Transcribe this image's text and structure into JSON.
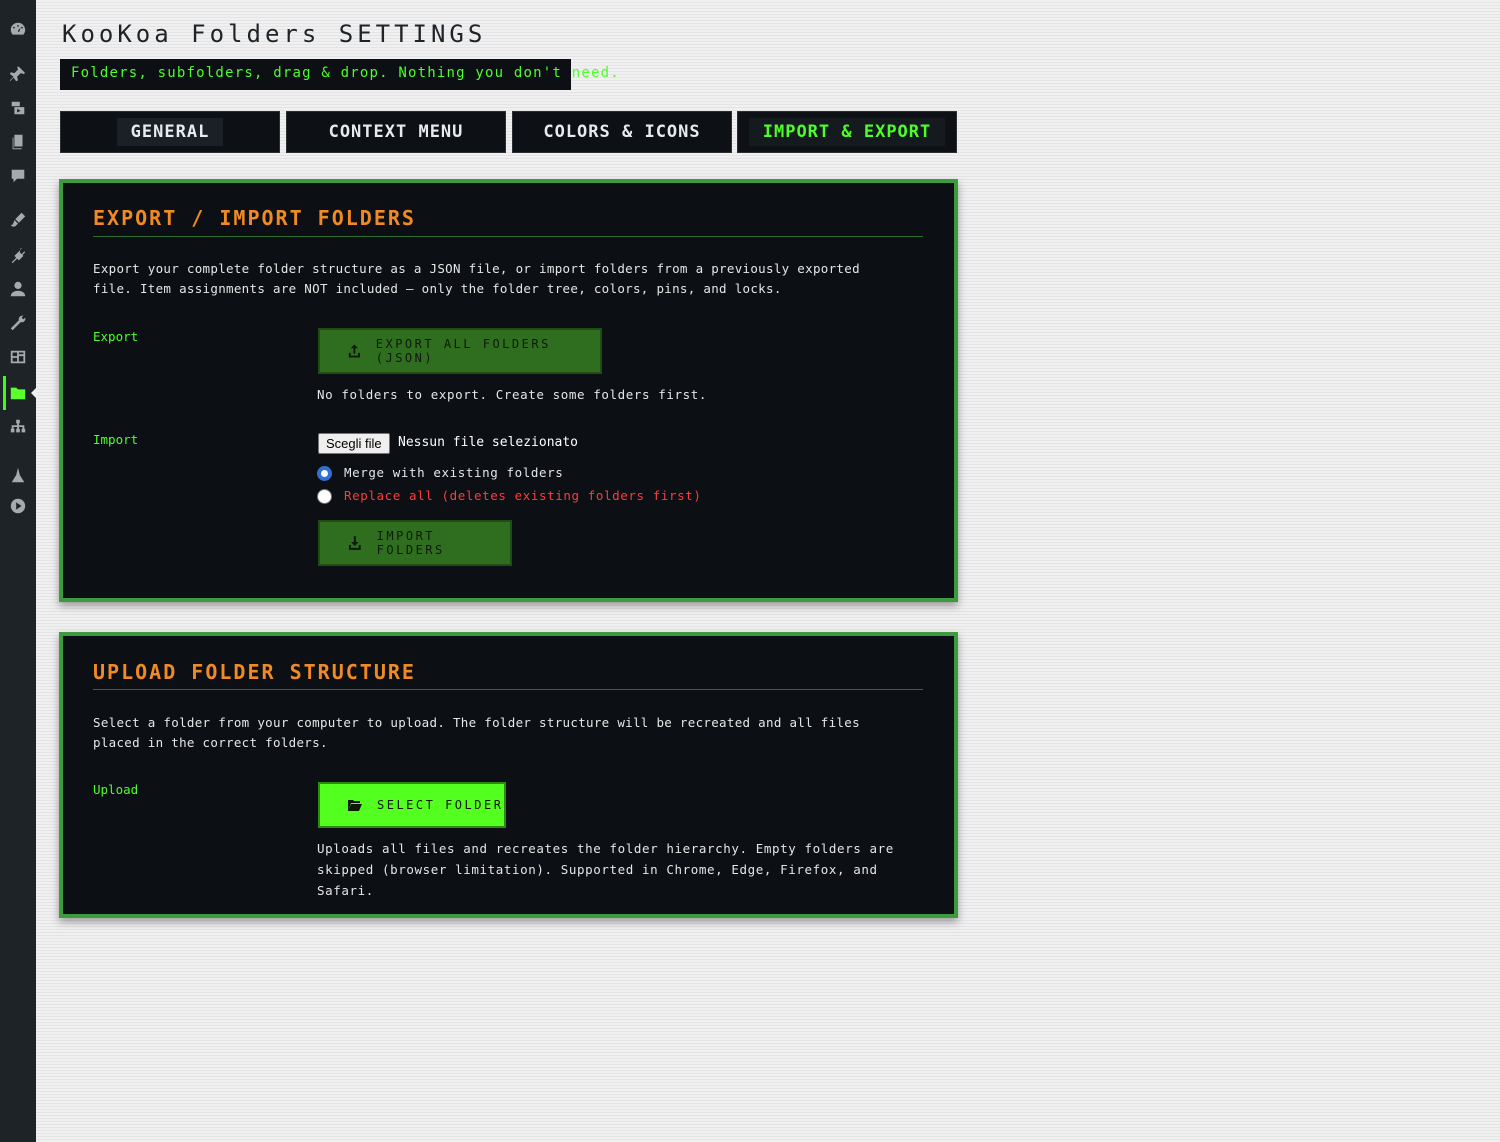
{
  "sidebar": {
    "items": [
      {
        "icon": "dashboard-icon"
      },
      {
        "icon": "pin-icon"
      },
      {
        "icon": "media-icon"
      },
      {
        "icon": "pages-icon"
      },
      {
        "icon": "comments-icon"
      },
      {
        "icon": "appearance-icon"
      },
      {
        "icon": "plugins-icon"
      },
      {
        "icon": "users-icon"
      },
      {
        "icon": "tools-icon"
      },
      {
        "icon": "settings-icon"
      },
      {
        "icon": "folder-icon",
        "active": true
      },
      {
        "icon": "sitemap-icon"
      },
      {
        "icon": "custom-plugin-icon"
      },
      {
        "icon": "play-icon"
      }
    ]
  },
  "header": {
    "title": "KooKoa Folders SETTINGS",
    "tagline": "Folders, subfolders, drag & drop. Nothing you don't need."
  },
  "tabs": [
    {
      "label": "GENERAL"
    },
    {
      "label": "CONTEXT MENU"
    },
    {
      "label": "COLORS & ICONS"
    },
    {
      "label": "IMPORT & EXPORT",
      "active": true
    }
  ],
  "export_panel": {
    "title": "EXPORT / IMPORT FOLDERS",
    "description": "Export your complete folder structure as a JSON file, or import folders from a previously exported file. Item assignments are NOT included — only the folder tree, colors, pins, and locks.",
    "export_label": "Export",
    "export_button": "EXPORT ALL FOLDERS (JSON)",
    "export_note": "No folders to export. Create some folders first.",
    "import_label": "Import",
    "file_button": "Scegli file",
    "file_status": "Nessun file selezionato",
    "merge_option": "Merge with existing folders",
    "replace_option": "Replace all (deletes existing folders first)",
    "import_button": "IMPORT FOLDERS"
  },
  "upload_panel": {
    "title": "UPLOAD FOLDER STRUCTURE",
    "description": "Select a folder from your computer to upload. The folder structure will be recreated and all files placed in the correct folders.",
    "upload_label": "Upload",
    "select_button": "SELECT FOLDER",
    "upload_note": "Uploads all files and recreates the folder hierarchy. Empty folders are skipped (browser limitation). Supported in Chrome, Edge, Firefox, and Safari."
  },
  "colors": {
    "accent_green": "#4cff26",
    "panel_border": "#3e9a3e",
    "title_orange": "#f08a24",
    "danger_red": "#ff3b3b"
  }
}
